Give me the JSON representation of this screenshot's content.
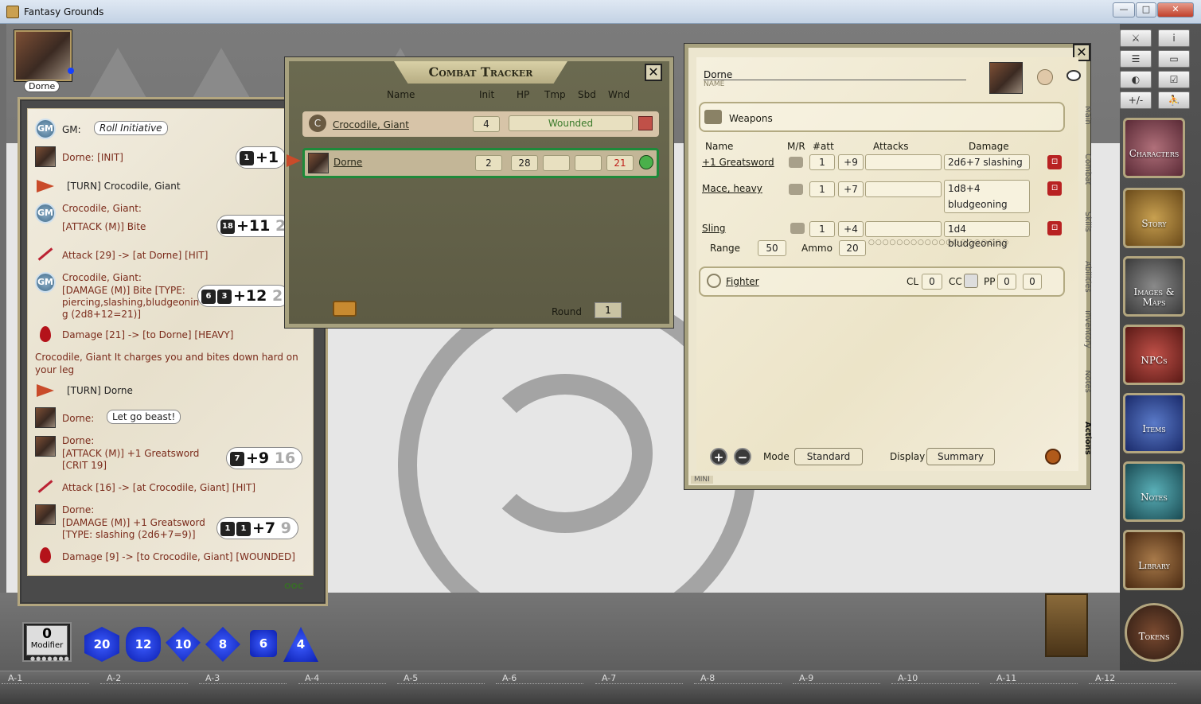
{
  "window": {
    "title": "Fantasy Grounds",
    "controls": [
      "—",
      "□",
      "✕"
    ]
  },
  "portrait": {
    "label": "Dorne"
  },
  "chat": {
    "entries": [
      {
        "speaker": "GM:",
        "bubble": "Roll Initiative"
      },
      {
        "text": "Dorne:   [INIT]",
        "roll": "+1",
        "dice": [
          "1"
        ]
      },
      {
        "text": "[TURN] Crocodile, Giant"
      },
      {
        "line1": "Crocodile, Giant:",
        "line2": "[ATTACK (M)] Bite",
        "roll": "+11",
        "ghost": "2",
        "dice": [
          "18"
        ]
      },
      {
        "text": "Attack [29] -> [at Dorne] [HIT]"
      },
      {
        "line1": "Crocodile, Giant:",
        "line2": "[DAMAGE (M)] Bite [TYPE:",
        "line3": "piercing,slashing,bludgeonin",
        "line4": "g (2d8+12=21)]",
        "roll": "+12",
        "ghost": "2",
        "dice": [
          "6",
          "3"
        ]
      },
      {
        "text": "Damage [21] -> [to Dorne] [HEAVY]"
      },
      {
        "text": "Crocodile, Giant It charges you and bites down hard on your leg"
      },
      {
        "text": "[TURN] Dorne"
      },
      {
        "speaker": "Dorne:",
        "bubble": "Let go beast!"
      },
      {
        "line1": "Dorne:",
        "line2": "[ATTACK (M)] +1 Greatsword",
        "line3": "[CRIT 19]",
        "roll": "+9",
        "ghost": "16",
        "dice": [
          "7"
        ]
      },
      {
        "text": "Attack [16] -> [at Crocodile, Giant] [HIT]"
      },
      {
        "line1": "Dorne:",
        "line2": "[DAMAGE (M)] +1 Greatsword",
        "line3": "[TYPE: slashing (2d6+7=9)]",
        "roll": "+7",
        "ghost": "9",
        "dice": [
          "1",
          "1"
        ]
      },
      {
        "text": "Damage [9] -> [to Crocodile, Giant] [WOUNDED]"
      }
    ],
    "ooc": "OOC"
  },
  "tracker": {
    "title": "Combat Tracker",
    "columns": [
      "Name",
      "Init",
      "HP",
      "Tmp",
      "Sbd",
      "Wnd"
    ],
    "rows": [
      {
        "name": "Crocodile, Giant",
        "init": "4",
        "status": "Wounded",
        "badge": "C"
      },
      {
        "name": "Dorne",
        "init": "2",
        "hp": "28",
        "tmp": "",
        "sbd": "",
        "wnd": "21"
      }
    ],
    "round_label": "Round",
    "round_value": "1"
  },
  "sheet": {
    "name": "Dorne",
    "name_caption": "NAME",
    "section_weapons": "Weapons",
    "headers": [
      "Name",
      "M/R",
      "#att",
      "Attacks",
      "Damage"
    ],
    "weapons": [
      {
        "name": "+1 Greatsword",
        "att": "1",
        "bonus": "+9",
        "damage": "2d6+7 slashing"
      },
      {
        "name": "Mace, heavy",
        "att": "1",
        "bonus": "+7",
        "damage": "1d8+4",
        "damage2": "bludgeoning"
      },
      {
        "name": "Sling",
        "att": "1",
        "bonus": "+4",
        "damage": "1d4 bludgeoning"
      }
    ],
    "range_label": "Range",
    "range_value": "50",
    "ammo_label": "Ammo",
    "ammo_value": "20",
    "pips": "○○○○○○○○○○○○○○○○○○○○",
    "class": "Fighter",
    "cl_label": "CL",
    "cl_value": "0",
    "cc_label": "CC",
    "pp_label": "PP",
    "pp_value1": "0",
    "pp_value2": "0",
    "tabs": [
      "Main",
      "Combat",
      "Skills",
      "Abilities",
      "Inventory",
      "Notes",
      "Actions"
    ],
    "mode_label": "Mode",
    "mode_value": "Standard",
    "display_label": "Display",
    "display_value": "Summary",
    "mini": "MINI"
  },
  "sidebar": {
    "buttons": [
      "Characters",
      "Story",
      "Images & Maps",
      "NPCs",
      "Items",
      "Notes",
      "Library"
    ],
    "tokens": "Tokens",
    "tools": [
      "⚔",
      "i",
      "☰",
      "▭",
      "◐",
      "☑",
      "+/-",
      "⛹"
    ]
  },
  "modifier": {
    "value": "0",
    "label": "Modifier",
    "pips": "●●●●●●●"
  },
  "dice": [
    "20",
    "12",
    "10",
    "8",
    "6",
    "4"
  ],
  "grid": [
    "A-1",
    "A-2",
    "A-3",
    "A-4",
    "A-5",
    "A-6",
    "A-7",
    "A-8",
    "A-9",
    "A-10",
    "A-11",
    "A-12"
  ]
}
